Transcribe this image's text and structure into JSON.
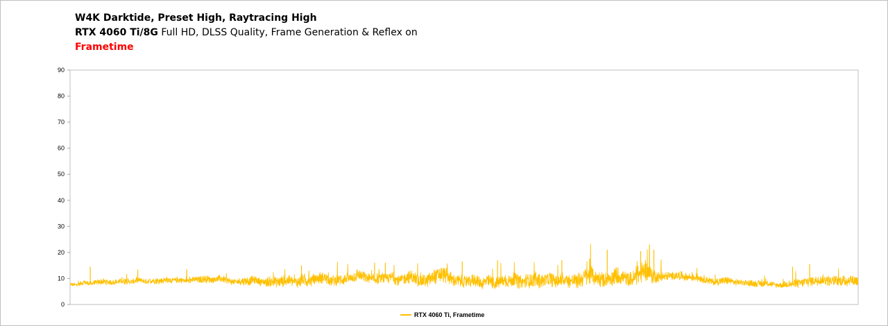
{
  "chart_data": {
    "type": "line",
    "title_line1": "W4K Darktide, Preset High, Raytracing High",
    "title_line2_bold": "RTX 4060 Ti/8G",
    "title_line2_rest": " Full HD, DLSS Quality, Frame Generation & Reflex on",
    "title_line3": "Frametime",
    "ylim": [
      0,
      90
    ],
    "yticks": [
      "0",
      "10",
      "20",
      "30",
      "40",
      "50",
      "60",
      "70",
      "80",
      "90"
    ],
    "grid": false,
    "legend_position": "bottom",
    "series": [
      {
        "name": "RTX 4060 Ti, Frametime",
        "color": "#ffc000",
        "baseline_profile": [
          7.8,
          7.5,
          8.5,
          8.0,
          8.6,
          8.8,
          8.5,
          8.7,
          9.0,
          8.6,
          9.5,
          8.8,
          9.2,
          9.0,
          9.5,
          9.2,
          9.5,
          9.0,
          9.5,
          9.6,
          9.8,
          9.4,
          10.0,
          9.2,
          8.5,
          9.0,
          9.0,
          9.5,
          8.5,
          8.8,
          8.8,
          9.0,
          9.2,
          8.5,
          9.5,
          9.0,
          9.8,
          10.5,
          9.0,
          9.5,
          9.8,
          10.0,
          11.5,
          10.5,
          9.5,
          10.0,
          10.0,
          10.5,
          9.0,
          10.5,
          10.5,
          9.0,
          9.0,
          10.5,
          11.5,
          11.0,
          9.2,
          9.0,
          8.5,
          9.5,
          8.0,
          9.0,
          8.0,
          9.0,
          9.0,
          9.5,
          8.5,
          9.5,
          9.0,
          9.0,
          10.0,
          9.0,
          9.5,
          9.0,
          9.0,
          10.5,
          11.5,
          10.0,
          9.5,
          10.5,
          11.0,
          10.0,
          9.5,
          11.5,
          13.5,
          11.0,
          10.5,
          10.8,
          11.0,
          11.2,
          10.5,
          10.5,
          10.0,
          9.5,
          8.5,
          9.0,
          9.2,
          8.5,
          8.5,
          8.2,
          8.0,
          8.0,
          8.0,
          7.5,
          7.5,
          7.8,
          8.0,
          8.5,
          9.0,
          9.5,
          9.5,
          9.0,
          9.0,
          9.0,
          9.5,
          9.0
        ],
        "spread_profile": [
          1.5,
          1.2,
          2.0,
          1.8,
          2.0,
          2.5,
          2.0,
          2.0,
          2.5,
          2.0,
          2.5,
          2.0,
          2.5,
          2.5,
          2.5,
          2.0,
          2.5,
          2.0,
          2.5,
          2.5,
          3.0,
          2.5,
          3.0,
          2.5,
          2.5,
          3.0,
          3.5,
          3.0,
          3.0,
          4.0,
          4.5,
          4.5,
          4.0,
          4.5,
          5.0,
          5.0,
          4.5,
          4.5,
          4.0,
          4.5,
          4.5,
          4.0,
          5.0,
          4.5,
          4.0,
          4.5,
          4.0,
          4.5,
          4.0,
          5.0,
          5.5,
          5.0,
          5.0,
          6.0,
          6.5,
          6.0,
          5.0,
          5.0,
          4.5,
          5.0,
          4.5,
          5.5,
          5.0,
          5.0,
          5.0,
          6.0,
          5.5,
          6.5,
          6.5,
          5.0,
          6.0,
          5.5,
          5.0,
          5.5,
          6.0,
          7.0,
          8.0,
          6.5,
          5.5,
          6.5,
          7.0,
          6.0,
          6.0,
          7.5,
          9.0,
          6.0,
          4.0,
          3.5,
          3.0,
          3.5,
          3.0,
          3.0,
          3.0,
          3.0,
          2.5,
          3.0,
          3.0,
          2.5,
          2.5,
          2.5,
          2.5,
          2.5,
          2.5,
          2.0,
          2.5,
          3.0,
          3.5,
          4.0,
          4.0,
          4.5,
          4.0,
          4.0,
          4.0,
          4.5,
          5.0,
          4.5
        ],
        "spikes": [
          {
            "position": 0.032,
            "value": 14.5
          },
          {
            "position": 0.185,
            "value": 13.5
          },
          {
            "position": 0.367,
            "value": 15.0
          },
          {
            "position": 0.483,
            "value": 16.0
          },
          {
            "position": 0.5,
            "value": 16.0
          },
          {
            "position": 0.622,
            "value": 16.5
          },
          {
            "position": 0.678,
            "value": 17.0
          },
          {
            "position": 0.78,
            "value": 17.0
          },
          {
            "position": 0.824,
            "value": 17.5
          },
          {
            "position": 0.852,
            "value": 21.0
          },
          {
            "position": 0.905,
            "value": 20.5
          },
          {
            "position": 0.919,
            "value": 23.0
          },
          {
            "position": 0.926,
            "value": 21.0
          },
          {
            "position": 1.146,
            "value": 14.5
          },
          {
            "position": 1.173,
            "value": 15.5
          }
        ]
      }
    ]
  }
}
